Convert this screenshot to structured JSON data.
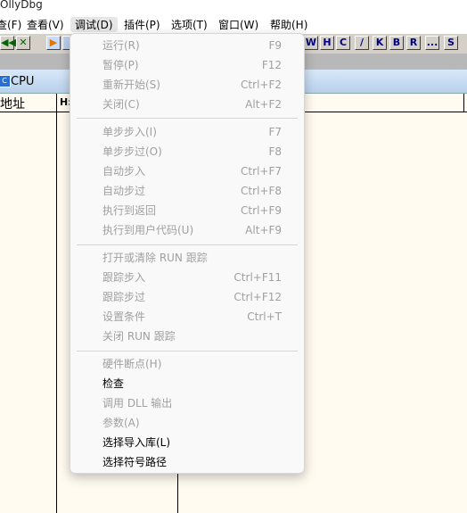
{
  "window": {
    "title": "OllyDbg"
  },
  "menubar": {
    "items": [
      "查(F)",
      "查看(V)",
      "调试(D)",
      "插件(P)",
      "选项(T)",
      "窗口(W)",
      "帮助(H)"
    ]
  },
  "toolbar": {
    "left_buttons": [
      "◀◀",
      "✕",
      "▶",
      ""
    ],
    "right_buttons": [
      "W",
      "H",
      "C",
      "/",
      "K",
      "B",
      "R",
      "...",
      "S"
    ]
  },
  "cpu_window": {
    "title": "CPU",
    "col_address": "地址",
    "col_hex": "H:"
  },
  "debug_menu": {
    "items": [
      {
        "label": "运行(R)",
        "shortcut": "F9",
        "enabled": false
      },
      {
        "label": "暂停(P)",
        "shortcut": "F12",
        "enabled": false
      },
      {
        "label": "重新开始(S)",
        "shortcut": "Ctrl+F2",
        "enabled": false
      },
      {
        "label": "关闭(C)",
        "shortcut": "Alt+F2",
        "enabled": false
      },
      {
        "label": "单步步入(I)",
        "shortcut": "F7",
        "enabled": false
      },
      {
        "label": "单步步过(O)",
        "shortcut": "F8",
        "enabled": false
      },
      {
        "label": "自动步入",
        "shortcut": "Ctrl+F7",
        "enabled": false
      },
      {
        "label": "自动步过",
        "shortcut": "Ctrl+F8",
        "enabled": false
      },
      {
        "label": "执行到返回",
        "shortcut": "Ctrl+F9",
        "enabled": false
      },
      {
        "label": "执行到用户代码(U)",
        "shortcut": "Alt+F9",
        "enabled": false
      },
      {
        "label": "打开或清除 RUN 跟踪",
        "shortcut": "",
        "enabled": false
      },
      {
        "label": "跟踪步入",
        "shortcut": "Ctrl+F11",
        "enabled": false
      },
      {
        "label": "跟踪步过",
        "shortcut": "Ctrl+F12",
        "enabled": false
      },
      {
        "label": "设置条件",
        "shortcut": "Ctrl+T",
        "enabled": false
      },
      {
        "label": "关闭 RUN 跟踪",
        "shortcut": "",
        "enabled": false
      },
      {
        "label": "硬件断点(H)",
        "shortcut": "",
        "enabled": false
      },
      {
        "label": "检查",
        "shortcut": "",
        "enabled": true
      },
      {
        "label": "调用 DLL 输出",
        "shortcut": "",
        "enabled": false
      },
      {
        "label": "参数(A)",
        "shortcut": "",
        "enabled": false
      },
      {
        "label": "选择导入库(L)",
        "shortcut": "",
        "enabled": true
      },
      {
        "label": "选择符号路径",
        "shortcut": "",
        "enabled": true
      }
    ]
  }
}
